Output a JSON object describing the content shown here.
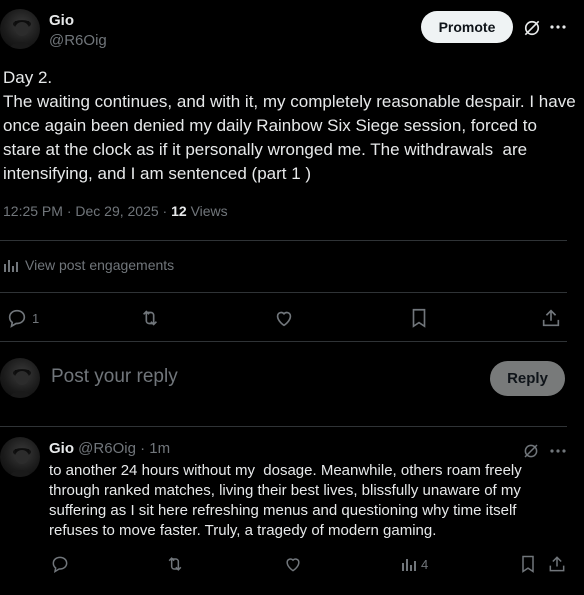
{
  "post": {
    "author_name": "Gio",
    "author_handle": "@R6Oig",
    "promote_label": "Promote",
    "text": "Day 2.\nThe waiting continues, and with it, my completely reasonable despair. I have once again been denied my daily Rainbow Six Siege session, forced to stare at the clock as if it personally wronged me. The withdrawals  are intensifying, and I am sentenced (part 1 )",
    "timestamp": "12:25 PM · Dec 29, 2025",
    "views_count": "12",
    "views_label": "Views",
    "engagements_label": "View post engagements",
    "reply_count": "1"
  },
  "composer": {
    "placeholder": "Post your reply",
    "reply_label": "Reply"
  },
  "reply": {
    "author_name": "Gio",
    "author_handle": "@R6Oig",
    "age": "· 1m",
    "text": "to another 24 hours without my  dosage. Meanwhile, others roam freely through ranked matches, living their best lives, blissfully unaware of my suffering as I sit here refreshing menus and questioning why time itself refuses to move faster. Truly, a tragedy of modern gaming.",
    "views_count": "4"
  },
  "icons": {
    "grok": "grok-icon",
    "more": "more-icon",
    "reply": "reply-icon",
    "repost": "repost-icon",
    "like": "like-icon",
    "bookmark": "bookmark-icon",
    "share": "share-icon",
    "analytics": "analytics-icon"
  }
}
